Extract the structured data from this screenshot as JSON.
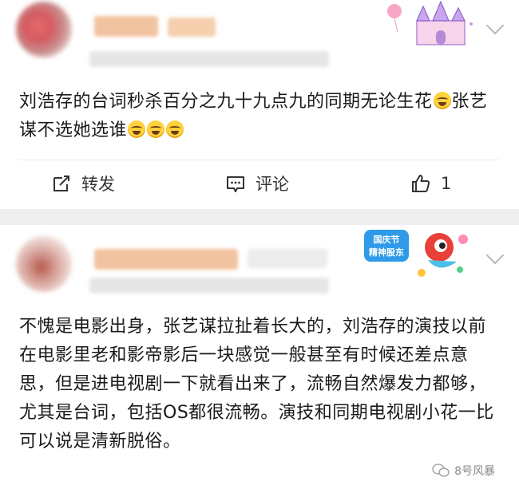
{
  "posts": [
    {
      "text_before_emoji": "刘浩存的台词秒杀百分之九十九点九的同期无论生花",
      "text_mid": "张艺谋不选她选谁",
      "actions": {
        "repost_label": "转发",
        "comment_label": "评论",
        "like_count": "1"
      }
    },
    {
      "badge_text": "国庆节\n精神股东",
      "text": "不愧是电影出身，张艺谋拉扯着长大的，刘浩存的演技以前在电影里老和影帝影后一块感觉一般甚至有时候还差点意思，但是进电视剧一下就看出来了，流畅自然爆发力都够，尤其是台词，包括OS都很流畅。演技和同期电视剧小花一比可以说是清新脱俗。"
    }
  ],
  "watermark": "8号风暴",
  "colors": {
    "text": "#1a1a1a",
    "divider": "#efefef",
    "icon": "#333333"
  }
}
